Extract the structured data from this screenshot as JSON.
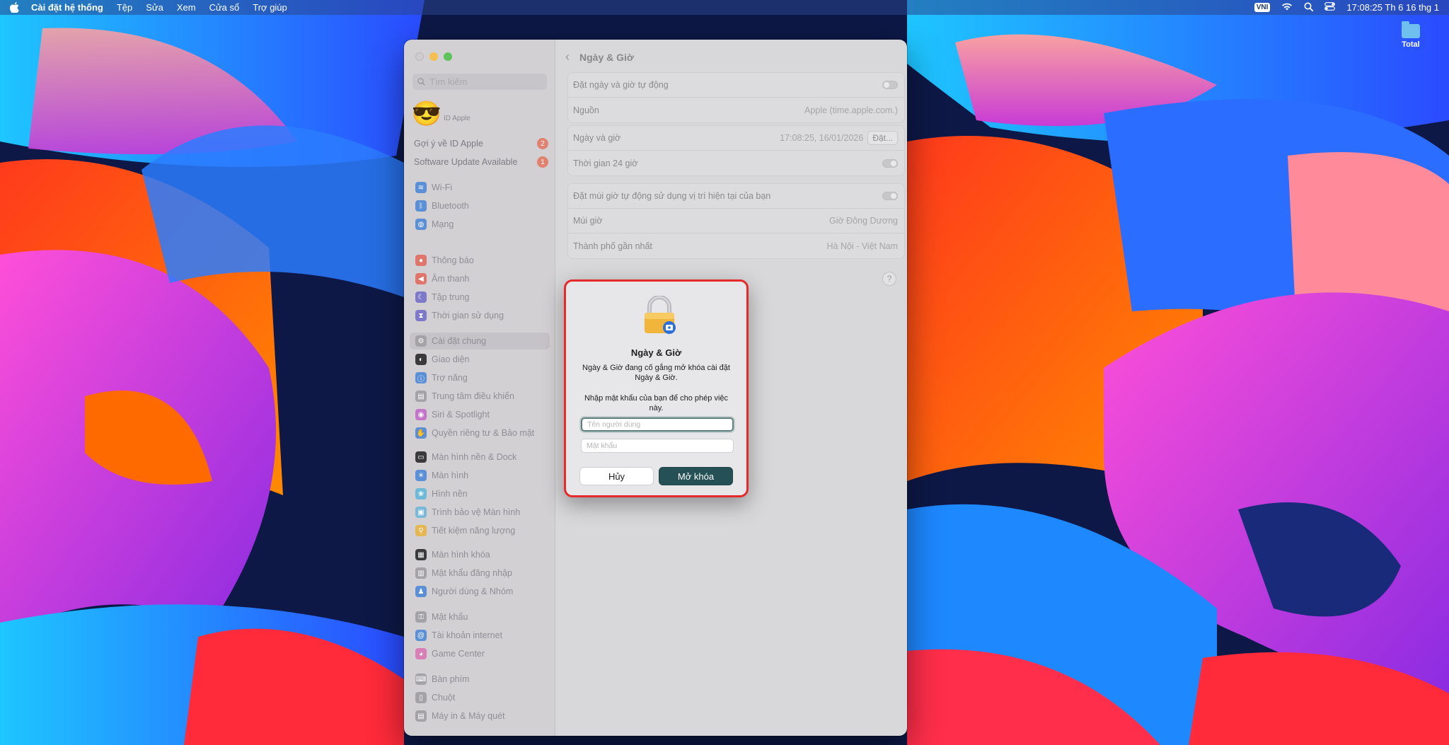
{
  "menubar": {
    "app_name": "Cài đặt hệ thống",
    "menus": [
      "Tệp",
      "Sửa",
      "Xem",
      "Cửa sổ",
      "Trợ giúp"
    ],
    "input_method": "VNI",
    "clock": "17:08:25 Th 6 16 thg 1"
  },
  "desktop": {
    "icon_label": "Total"
  },
  "sidebar": {
    "search_placeholder": "Tìm kiếm",
    "apple_id_label": "ID Apple",
    "notices": [
      {
        "label": "Gợi ý về ID Apple",
        "badge": "2"
      },
      {
        "label": "Software Update Available",
        "badge": "1"
      }
    ],
    "items": [
      {
        "label": "Wi-Fi",
        "icon": "wifi-icon",
        "color": "#5b8fd6"
      },
      {
        "label": "Bluetooth",
        "icon": "bluetooth-icon",
        "color": "#5b8fd6"
      },
      {
        "label": "Mạng",
        "icon": "globe-icon",
        "color": "#5b8fd6"
      },
      {
        "label": "Thông báo",
        "icon": "bell-icon",
        "color": "#e0756c"
      },
      {
        "label": "Âm thanh",
        "icon": "speaker-icon",
        "color": "#e0756c"
      },
      {
        "label": "Tập trung",
        "icon": "moon-icon",
        "color": "#7e79c9"
      },
      {
        "label": "Thời gian sử dụng",
        "icon": "hourglass-icon",
        "color": "#7e79c9"
      },
      {
        "label": "Cài đặt chung",
        "icon": "gear-icon",
        "color": "#a3a2a6"
      },
      {
        "label": "Giao diện",
        "icon": "appearance-icon",
        "color": "#3a3a3c"
      },
      {
        "label": "Trợ năng",
        "icon": "accessibility-icon",
        "color": "#5b8fd6"
      },
      {
        "label": "Trung tâm điều khiển",
        "icon": "control-center-icon",
        "color": "#a3a2a6"
      },
      {
        "label": "Siri & Spotlight",
        "icon": "siri-icon",
        "color": "#c474c9"
      },
      {
        "label": "Quyền riêng tư & Bảo mật",
        "icon": "hand-icon",
        "color": "#5b8fd6"
      },
      {
        "label": "Màn hình nền & Dock",
        "icon": "dock-icon",
        "color": "#3a3a3c"
      },
      {
        "label": "Màn hình",
        "icon": "sun-icon",
        "color": "#5b8fd6"
      },
      {
        "label": "Hình nền",
        "icon": "wallpaper-icon",
        "color": "#6cb9d8"
      },
      {
        "label": "Trình bảo vệ Màn hình",
        "icon": "screensaver-icon",
        "color": "#7ab8d8"
      },
      {
        "label": "Tiết kiệm năng lượng",
        "icon": "bulb-icon",
        "color": "#e6b653"
      },
      {
        "label": "Màn hình khóa",
        "icon": "lock-screen-icon",
        "color": "#3a3a3c"
      },
      {
        "label": "Mật khẩu đăng nhập",
        "icon": "login-lock-icon",
        "color": "#a3a2a6"
      },
      {
        "label": "Người dùng & Nhóm",
        "icon": "users-icon",
        "color": "#5b8fd6"
      },
      {
        "label": "Mật khẩu",
        "icon": "key-icon",
        "color": "#a3a2a6"
      },
      {
        "label": "Tài khoản internet",
        "icon": "at-icon",
        "color": "#5b8fd6"
      },
      {
        "label": "Game Center",
        "icon": "game-center-icon",
        "color": "#d87fb8"
      },
      {
        "label": "Bàn phím",
        "icon": "keyboard-icon",
        "color": "#a3a2a6"
      },
      {
        "label": "Chuột",
        "icon": "mouse-icon",
        "color": "#a3a2a6"
      },
      {
        "label": "Máy in & Máy quét",
        "icon": "printer-icon",
        "color": "#a3a2a6"
      }
    ]
  },
  "content": {
    "title": "Ngày & Giờ",
    "groups": [
      {
        "rows": [
          {
            "label": "Đặt ngày và giờ tự động",
            "kind": "toggle",
            "on": false
          },
          {
            "label": "Nguồn",
            "value": "Apple (time.apple.com.)"
          }
        ]
      },
      {
        "rows": [
          {
            "label": "Ngày và giờ",
            "value": "17:08:25, 16/01/2026",
            "button": "Đặt..."
          },
          {
            "label": "Thời gian 24 giờ",
            "kind": "toggle",
            "on": true
          }
        ]
      },
      {
        "rows": [
          {
            "label": "Đặt múi giờ tự động sử dụng vị trí hiện tại của bạn",
            "kind": "toggle",
            "on": true
          },
          {
            "label": "Múi giờ",
            "value": "Giờ Đông Dương"
          },
          {
            "label": "Thành phố gần nhất",
            "value": "Hà Nội - Việt Nam"
          }
        ]
      }
    ],
    "help": "?"
  },
  "dialog": {
    "title": "Ngày & Giờ",
    "message": "Ngày & Giờ đang cố gắng mở khóa cài đặt Ngày & Giờ.",
    "prompt": "Nhập mật khẩu của bạn để cho phép việc này.",
    "username_placeholder": "Tên người dùng",
    "password_placeholder": "Mật khẩu",
    "cancel": "Hủy",
    "unlock": "Mở khóa",
    "highlight_color": "#e52a2a",
    "accent_color": "#255055"
  }
}
